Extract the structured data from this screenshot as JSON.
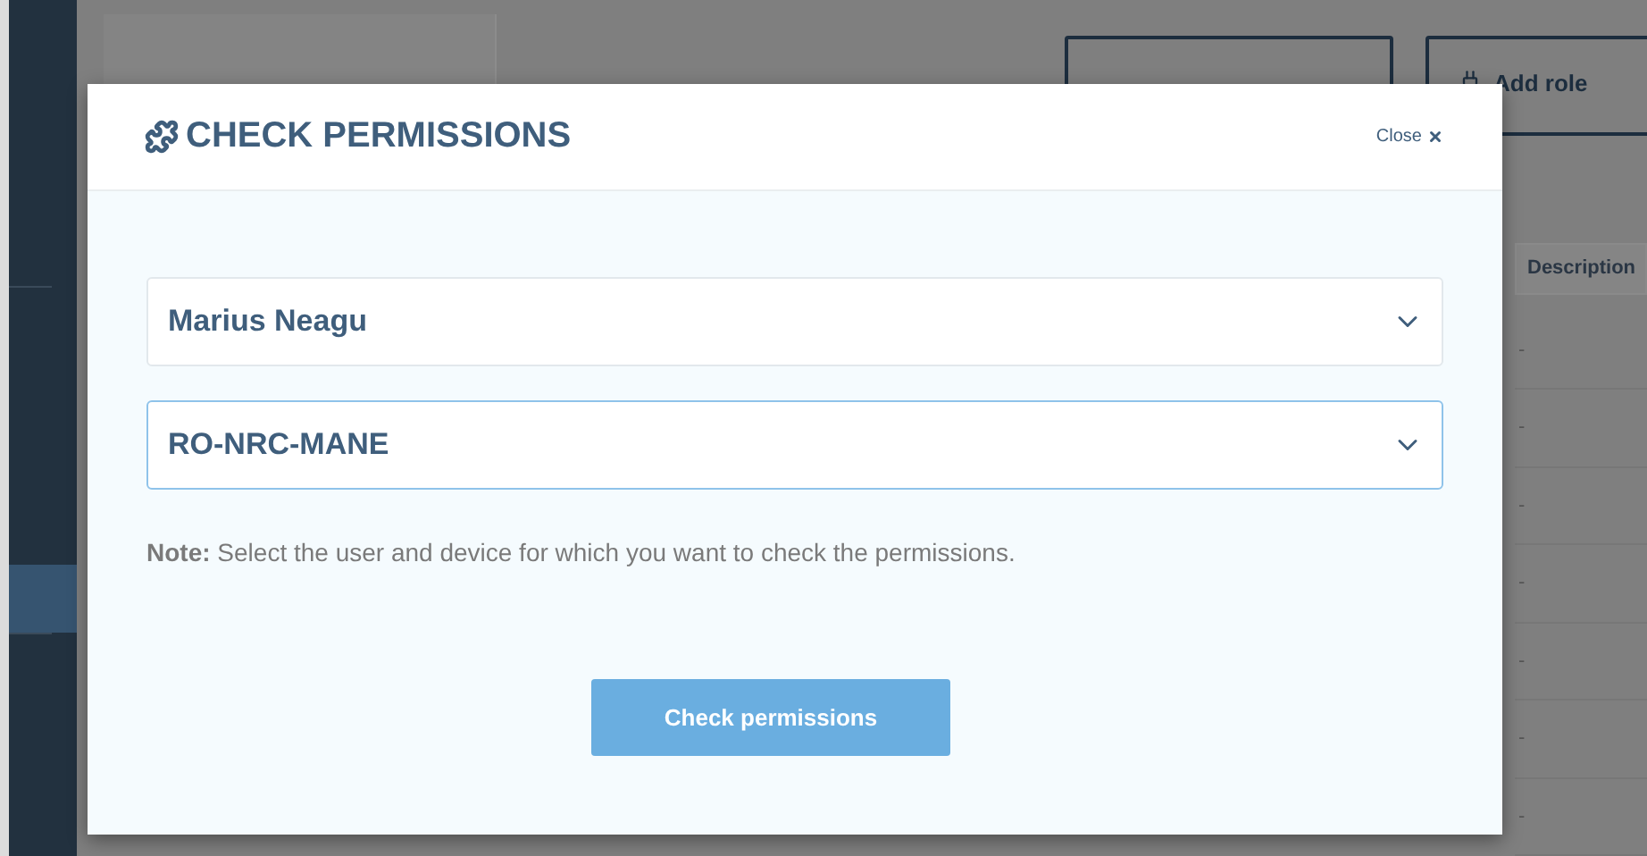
{
  "sidebar": {
    "items": [
      {
        "selected": false
      },
      {
        "selected": true
      },
      {
        "selected": false
      }
    ]
  },
  "page": {
    "buttons": [
      {
        "kind": "covered"
      },
      {
        "label": "Add role",
        "kind": "add"
      }
    ]
  },
  "table": {
    "columns": [
      "Description"
    ],
    "rows": [
      {
        "description": "-"
      },
      {
        "description": "-"
      },
      {
        "description": "-"
      },
      {
        "description": "-"
      },
      {
        "description": "-"
      },
      {
        "description": "-"
      },
      {
        "description": "-"
      }
    ]
  },
  "dialog": {
    "title": "CHECK PERMISSIONS",
    "close": "Close",
    "fields": [
      {
        "value": "Marius Neagu",
        "focused": false
      },
      {
        "value": "RO-NRC-MANE",
        "focused": true
      }
    ],
    "note": "**Note:** Select the user and device for which you want to check the permissions.",
    "submit": "Check permissions"
  }
}
